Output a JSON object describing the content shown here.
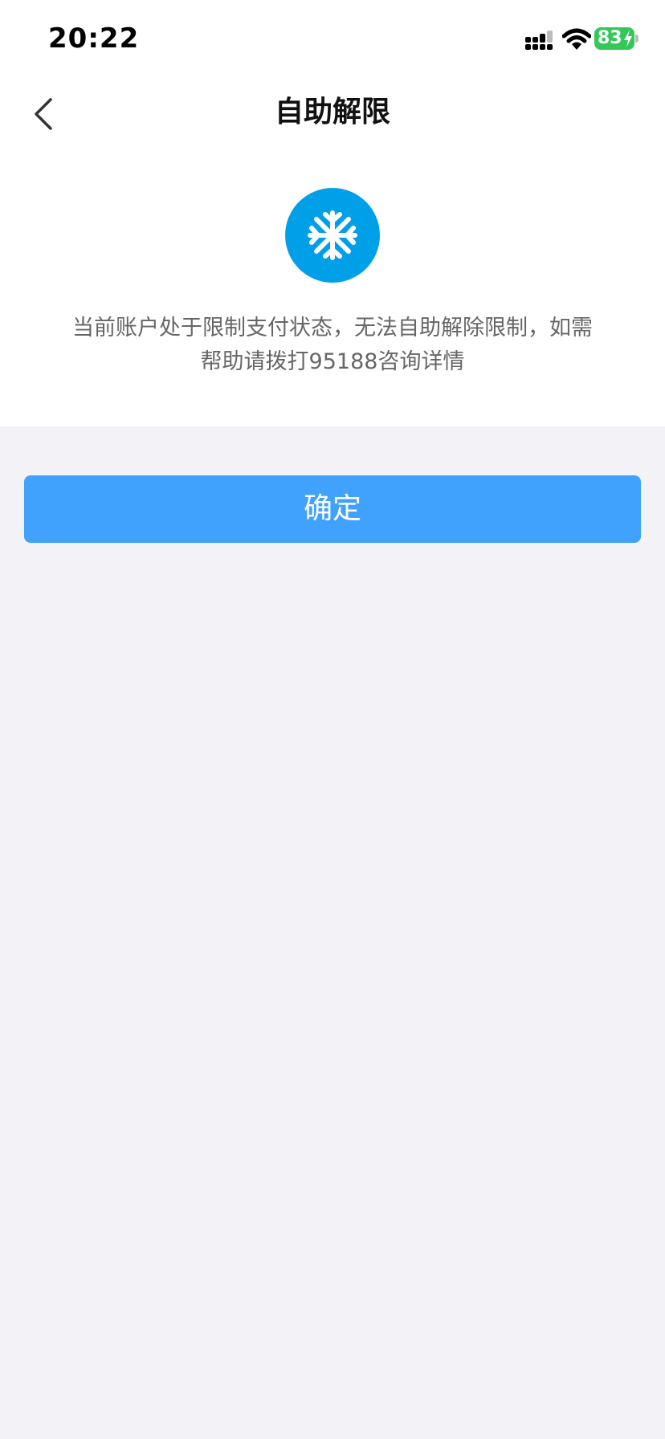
{
  "status_bar": {
    "time": "20:22",
    "battery": "83"
  },
  "nav": {
    "title": "自助解限",
    "back_icon": "chevron-left-icon"
  },
  "content": {
    "status_icon": "snowflake-icon",
    "message": "当前账户处于限制支付状态，无法自助解除限制，如需帮助请拨打95188咨询详情"
  },
  "actions": {
    "confirm_label": "确定"
  },
  "colors": {
    "accent_button": "#40a2fd",
    "icon_circle": "#00a0e9",
    "battery": "#34c759",
    "page_background": "#f2f2f7"
  }
}
